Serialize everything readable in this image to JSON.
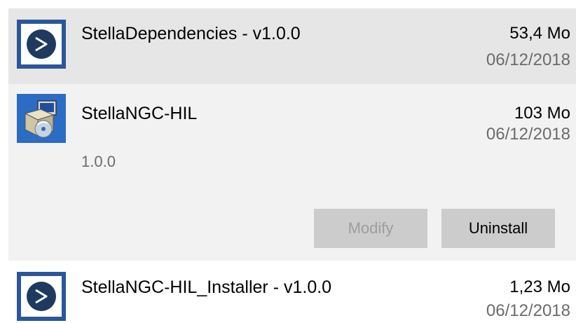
{
  "apps": [
    {
      "name": "StellaDependencies - v1.0.0",
      "size": "53,4 Mo",
      "date": "06/12/2018",
      "icon": "stella-logo-icon"
    },
    {
      "name": "StellaNGC-HIL",
      "size": "103 Mo",
      "date": "06/12/2018",
      "version": "1.0.0",
      "icon": "installer-package-icon",
      "selected": true,
      "modify_label": "Modify",
      "modify_enabled": false,
      "uninstall_label": "Uninstall"
    },
    {
      "name": "StellaNGC-HIL_Installer - v1.0.0",
      "size": "1,23 Mo",
      "date": "06/12/2018",
      "icon": "stella-logo-icon"
    }
  ],
  "colors": {
    "hover_row": "#e6e6e6",
    "selected_row": "#f2f2f2",
    "icon_border": "#2b579a",
    "icon_circle": "#1e3a5f",
    "secondary_text": "#6b6b6b",
    "button_bg": "#cccccc",
    "disabled_text": "#9d9d9d"
  }
}
